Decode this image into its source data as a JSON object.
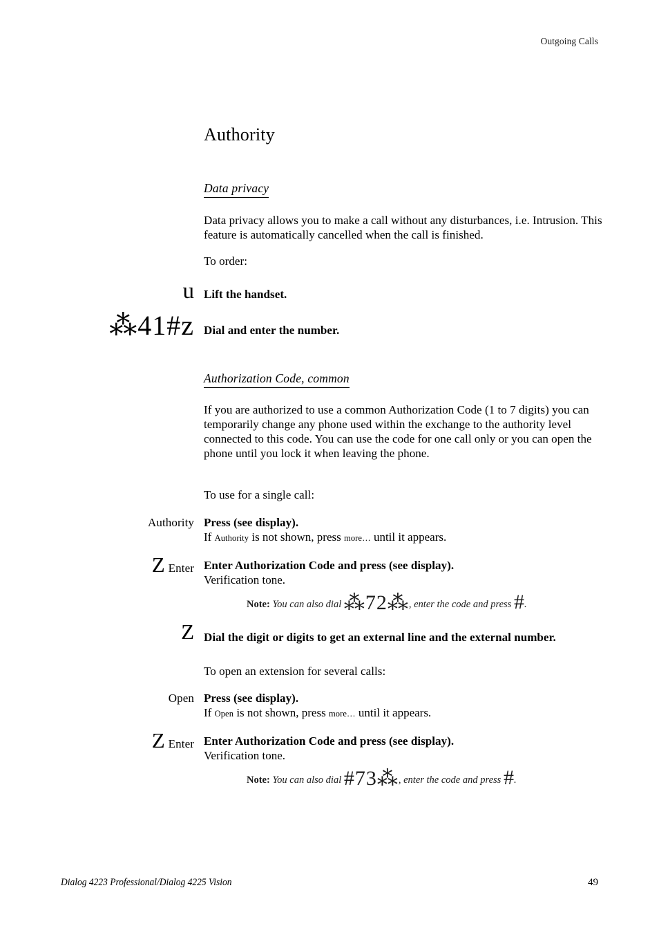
{
  "page": {
    "running_head": "Outgoing Calls",
    "title": "Authority",
    "footer_title": "Dialog 4223 Professional/Dialog 4225 Vision",
    "footer_page": "49"
  },
  "sections": {
    "data_privacy": {
      "heading": "Data privacy",
      "paragraph": "Data privacy allows you to make a call without any disturbances, i.e. Intrusion. This feature is automatically cancelled when the call is finished.",
      "lead_in": "To order:",
      "steps": [
        {
          "glyph": "u",
          "glyph_name": "handset-symbol",
          "instruction": "Lift the handset."
        },
        {
          "glyph": "⁂41#z",
          "glyph_name": "dial-code-star-41-hash-z",
          "instruction": "Dial and enter the number."
        }
      ]
    },
    "authorization_code": {
      "heading": "Authorization Code, common",
      "paragraph": "If you are authorized to use a common Authorization Code (1 to 7 digits) you can temporarily change any phone used within the exchange to the authority level connected to this code. You can use the code for one call only or you can open the phone until you lock it when leaving the phone.",
      "single_call": {
        "lead_in": "To use for a single call:",
        "step_authority": {
          "left_label": "Authority",
          "instruction": "Press (see display).",
          "detail_pre": "If ",
          "detail_softkey_1": "Authority",
          "detail_mid": " is not shown, press ",
          "detail_softkey_2": "more…",
          "detail_post": " until it appears."
        },
        "step_enter": {
          "glyph": "Z",
          "glyph_name": "keypad-z-symbol",
          "left_label": "Enter",
          "instruction": "Enter Authorization Code and press (see display).",
          "detail": "Verification tone.",
          "note_label": "Note:",
          "note_pre": "You can also dial ",
          "note_code": "⁂72⁂",
          "note_mid": ", enter the code and press ",
          "note_hash": "#",
          "note_post": "."
        },
        "step_dial": {
          "glyph": "Z",
          "glyph_name": "keypad-z-symbol",
          "instruction": "Dial the digit or digits to get an external line and the external number."
        }
      },
      "several_calls": {
        "lead_in": "To open an extension for several calls:",
        "step_open": {
          "left_label": "Open",
          "instruction": "Press (see display).",
          "detail_pre": "If ",
          "detail_softkey_1": "Open",
          "detail_mid": " is not shown, press ",
          "detail_softkey_2": "more…",
          "detail_post": " until it appears."
        },
        "step_enter": {
          "glyph": "Z",
          "glyph_name": "keypad-z-symbol",
          "left_label": "Enter",
          "instruction": "Enter Authorization Code and press (see display).",
          "detail": "Verification tone.",
          "note_label": "Note:",
          "note_pre": "You can also dial ",
          "note_code": "#73⁂",
          "note_mid": ", enter the code and press ",
          "note_hash": "#",
          "note_post": "."
        }
      }
    }
  }
}
